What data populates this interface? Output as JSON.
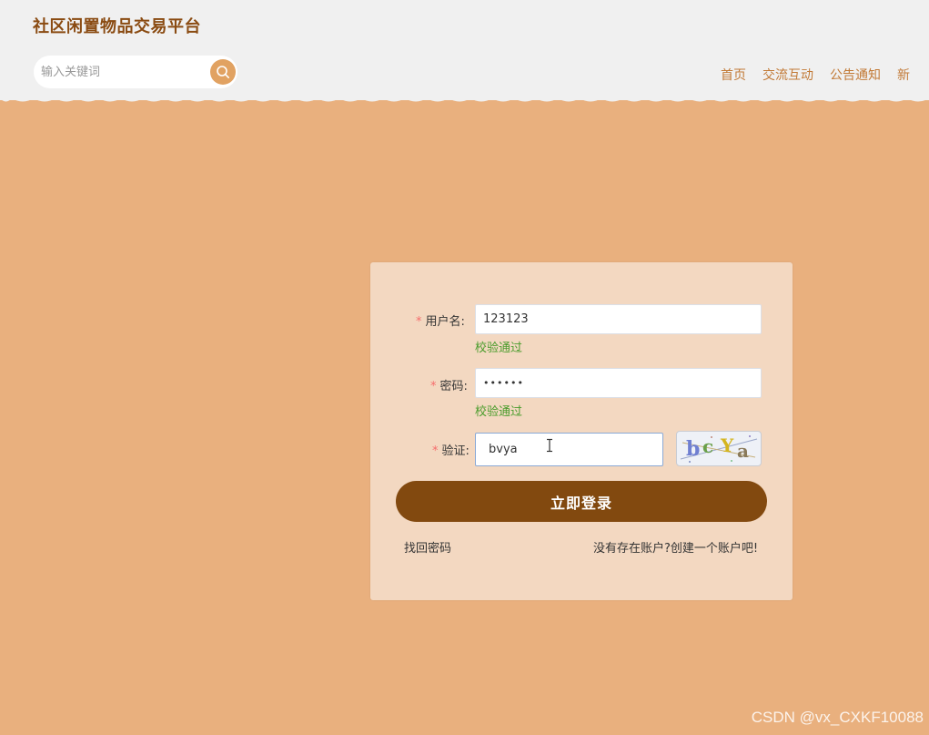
{
  "header": {
    "site_title": "社区闲置物品交易平台",
    "search": {
      "placeholder": "输入关键词",
      "value": "",
      "button_icon": "search-icon"
    },
    "nav": [
      "首页",
      "交流互动",
      "公告通知",
      "新"
    ]
  },
  "login_form": {
    "username": {
      "required_mark": "*",
      "label": "用户名:",
      "value": "123123",
      "validation": "校验通过"
    },
    "password": {
      "required_mark": "*",
      "label": "密码:",
      "display_value": "••••••",
      "validation": "校验通过"
    },
    "captcha": {
      "required_mark": "*",
      "label": "验证:",
      "value": "bvya",
      "image_text": "bcYa"
    },
    "submit_label": "立即登录",
    "forgot_password": "找回密码",
    "register_link": "没有存在账户?创建一个账户吧!"
  },
  "watermark": "CSDN @vx_CXKF10088",
  "colors": {
    "background": "#e9b07e",
    "header_bg": "#f0f0f0",
    "title": "#8a4b12",
    "nav": "#c27a37",
    "card": "#f3d8c1",
    "button": "#82490f",
    "success": "#4a9c2c",
    "required": "#f56c6c"
  }
}
